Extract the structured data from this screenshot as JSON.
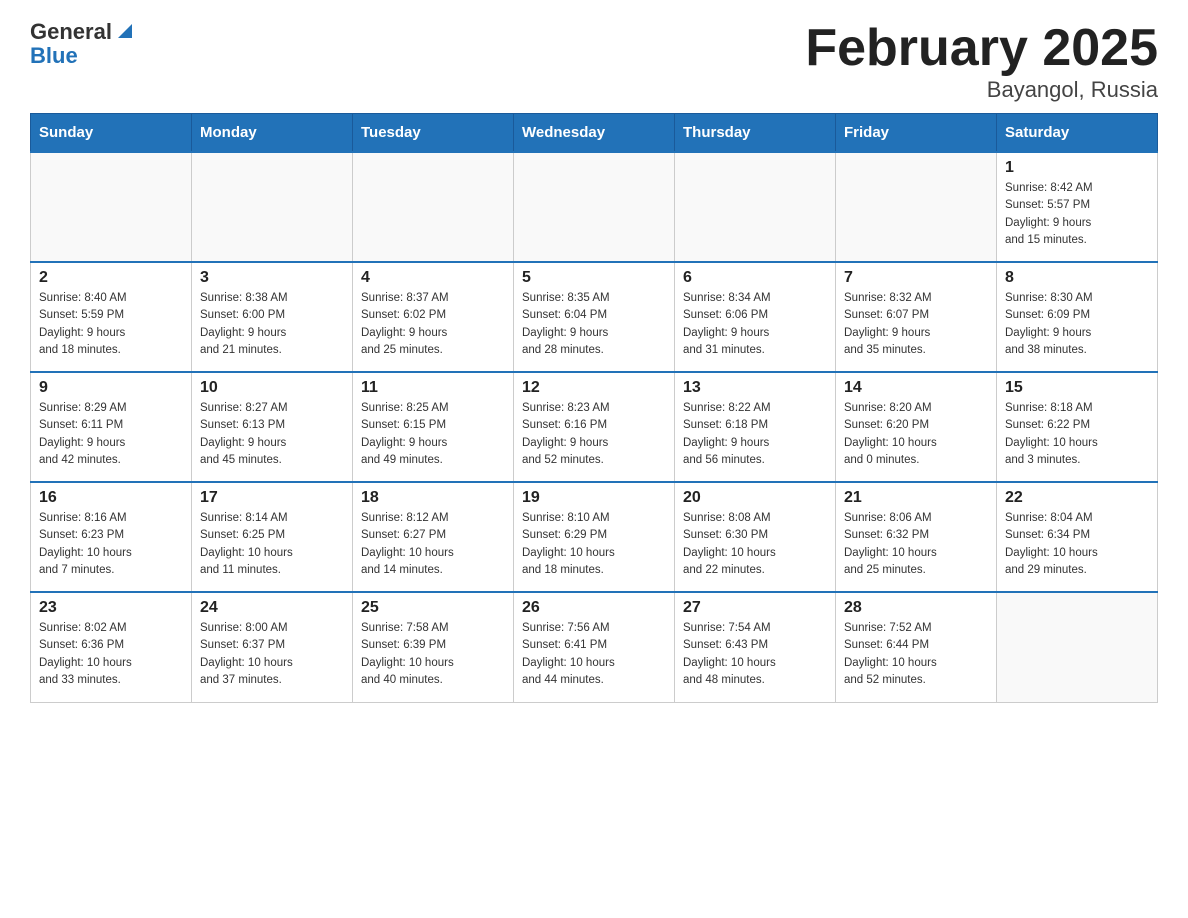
{
  "logo": {
    "general": "General",
    "blue": "Blue"
  },
  "title": "February 2025",
  "subtitle": "Bayangol, Russia",
  "weekdays": [
    "Sunday",
    "Monday",
    "Tuesday",
    "Wednesday",
    "Thursday",
    "Friday",
    "Saturday"
  ],
  "weeks": [
    [
      {
        "day": "",
        "info": ""
      },
      {
        "day": "",
        "info": ""
      },
      {
        "day": "",
        "info": ""
      },
      {
        "day": "",
        "info": ""
      },
      {
        "day": "",
        "info": ""
      },
      {
        "day": "",
        "info": ""
      },
      {
        "day": "1",
        "info": "Sunrise: 8:42 AM\nSunset: 5:57 PM\nDaylight: 9 hours\nand 15 minutes."
      }
    ],
    [
      {
        "day": "2",
        "info": "Sunrise: 8:40 AM\nSunset: 5:59 PM\nDaylight: 9 hours\nand 18 minutes."
      },
      {
        "day": "3",
        "info": "Sunrise: 8:38 AM\nSunset: 6:00 PM\nDaylight: 9 hours\nand 21 minutes."
      },
      {
        "day": "4",
        "info": "Sunrise: 8:37 AM\nSunset: 6:02 PM\nDaylight: 9 hours\nand 25 minutes."
      },
      {
        "day": "5",
        "info": "Sunrise: 8:35 AM\nSunset: 6:04 PM\nDaylight: 9 hours\nand 28 minutes."
      },
      {
        "day": "6",
        "info": "Sunrise: 8:34 AM\nSunset: 6:06 PM\nDaylight: 9 hours\nand 31 minutes."
      },
      {
        "day": "7",
        "info": "Sunrise: 8:32 AM\nSunset: 6:07 PM\nDaylight: 9 hours\nand 35 minutes."
      },
      {
        "day": "8",
        "info": "Sunrise: 8:30 AM\nSunset: 6:09 PM\nDaylight: 9 hours\nand 38 minutes."
      }
    ],
    [
      {
        "day": "9",
        "info": "Sunrise: 8:29 AM\nSunset: 6:11 PM\nDaylight: 9 hours\nand 42 minutes."
      },
      {
        "day": "10",
        "info": "Sunrise: 8:27 AM\nSunset: 6:13 PM\nDaylight: 9 hours\nand 45 minutes."
      },
      {
        "day": "11",
        "info": "Sunrise: 8:25 AM\nSunset: 6:15 PM\nDaylight: 9 hours\nand 49 minutes."
      },
      {
        "day": "12",
        "info": "Sunrise: 8:23 AM\nSunset: 6:16 PM\nDaylight: 9 hours\nand 52 minutes."
      },
      {
        "day": "13",
        "info": "Sunrise: 8:22 AM\nSunset: 6:18 PM\nDaylight: 9 hours\nand 56 minutes."
      },
      {
        "day": "14",
        "info": "Sunrise: 8:20 AM\nSunset: 6:20 PM\nDaylight: 10 hours\nand 0 minutes."
      },
      {
        "day": "15",
        "info": "Sunrise: 8:18 AM\nSunset: 6:22 PM\nDaylight: 10 hours\nand 3 minutes."
      }
    ],
    [
      {
        "day": "16",
        "info": "Sunrise: 8:16 AM\nSunset: 6:23 PM\nDaylight: 10 hours\nand 7 minutes."
      },
      {
        "day": "17",
        "info": "Sunrise: 8:14 AM\nSunset: 6:25 PM\nDaylight: 10 hours\nand 11 minutes."
      },
      {
        "day": "18",
        "info": "Sunrise: 8:12 AM\nSunset: 6:27 PM\nDaylight: 10 hours\nand 14 minutes."
      },
      {
        "day": "19",
        "info": "Sunrise: 8:10 AM\nSunset: 6:29 PM\nDaylight: 10 hours\nand 18 minutes."
      },
      {
        "day": "20",
        "info": "Sunrise: 8:08 AM\nSunset: 6:30 PM\nDaylight: 10 hours\nand 22 minutes."
      },
      {
        "day": "21",
        "info": "Sunrise: 8:06 AM\nSunset: 6:32 PM\nDaylight: 10 hours\nand 25 minutes."
      },
      {
        "day": "22",
        "info": "Sunrise: 8:04 AM\nSunset: 6:34 PM\nDaylight: 10 hours\nand 29 minutes."
      }
    ],
    [
      {
        "day": "23",
        "info": "Sunrise: 8:02 AM\nSunset: 6:36 PM\nDaylight: 10 hours\nand 33 minutes."
      },
      {
        "day": "24",
        "info": "Sunrise: 8:00 AM\nSunset: 6:37 PM\nDaylight: 10 hours\nand 37 minutes."
      },
      {
        "day": "25",
        "info": "Sunrise: 7:58 AM\nSunset: 6:39 PM\nDaylight: 10 hours\nand 40 minutes."
      },
      {
        "day": "26",
        "info": "Sunrise: 7:56 AM\nSunset: 6:41 PM\nDaylight: 10 hours\nand 44 minutes."
      },
      {
        "day": "27",
        "info": "Sunrise: 7:54 AM\nSunset: 6:43 PM\nDaylight: 10 hours\nand 48 minutes."
      },
      {
        "day": "28",
        "info": "Sunrise: 7:52 AM\nSunset: 6:44 PM\nDaylight: 10 hours\nand 52 minutes."
      },
      {
        "day": "",
        "info": ""
      }
    ]
  ]
}
